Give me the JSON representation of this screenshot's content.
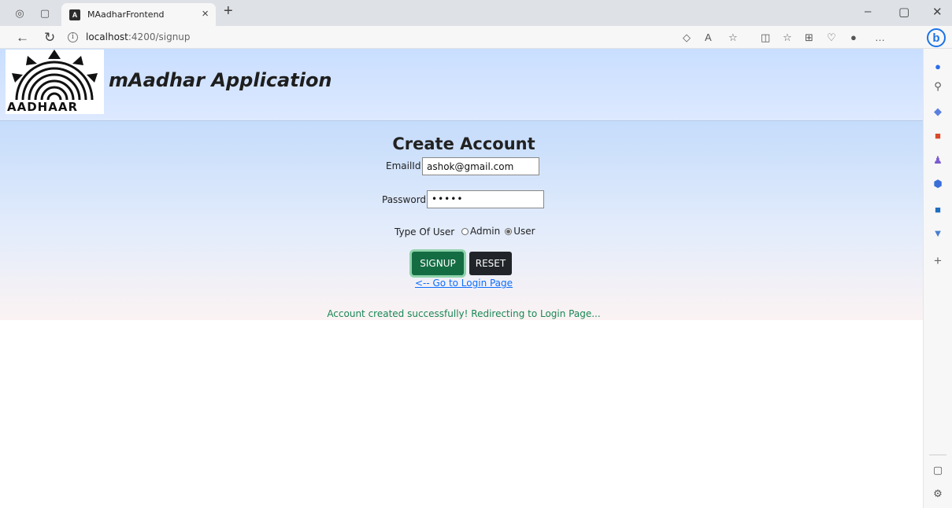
{
  "browser": {
    "tab_title": "MAadharFrontend",
    "url_host": "localhost",
    "url_path": ":4200/signup",
    "colors": {
      "tabbar": "#dee1e6",
      "toolbar": "#f7f7f7",
      "accent": "#1a73e8"
    }
  },
  "header": {
    "logo_text": "AADHAAR",
    "app_title": "mAadhar Application"
  },
  "form": {
    "title": "Create Account",
    "email_label": "EmailId",
    "email_value": "ashok@gmail.com",
    "password_label": "Password",
    "password_value": "•••••",
    "user_type_label": "Type Of User",
    "options": [
      "Admin",
      "User"
    ],
    "selected_option": "User",
    "signup_label": "SIGNUP",
    "reset_label": "RESET",
    "login_link": "<-- Go to Login Page",
    "success_message": "Account created successfully! Redirecting to Login Page..."
  },
  "colors": {
    "signup_button": "#146c43",
    "reset_button": "#212529",
    "link": "#0d6efd",
    "success": "#198754"
  }
}
